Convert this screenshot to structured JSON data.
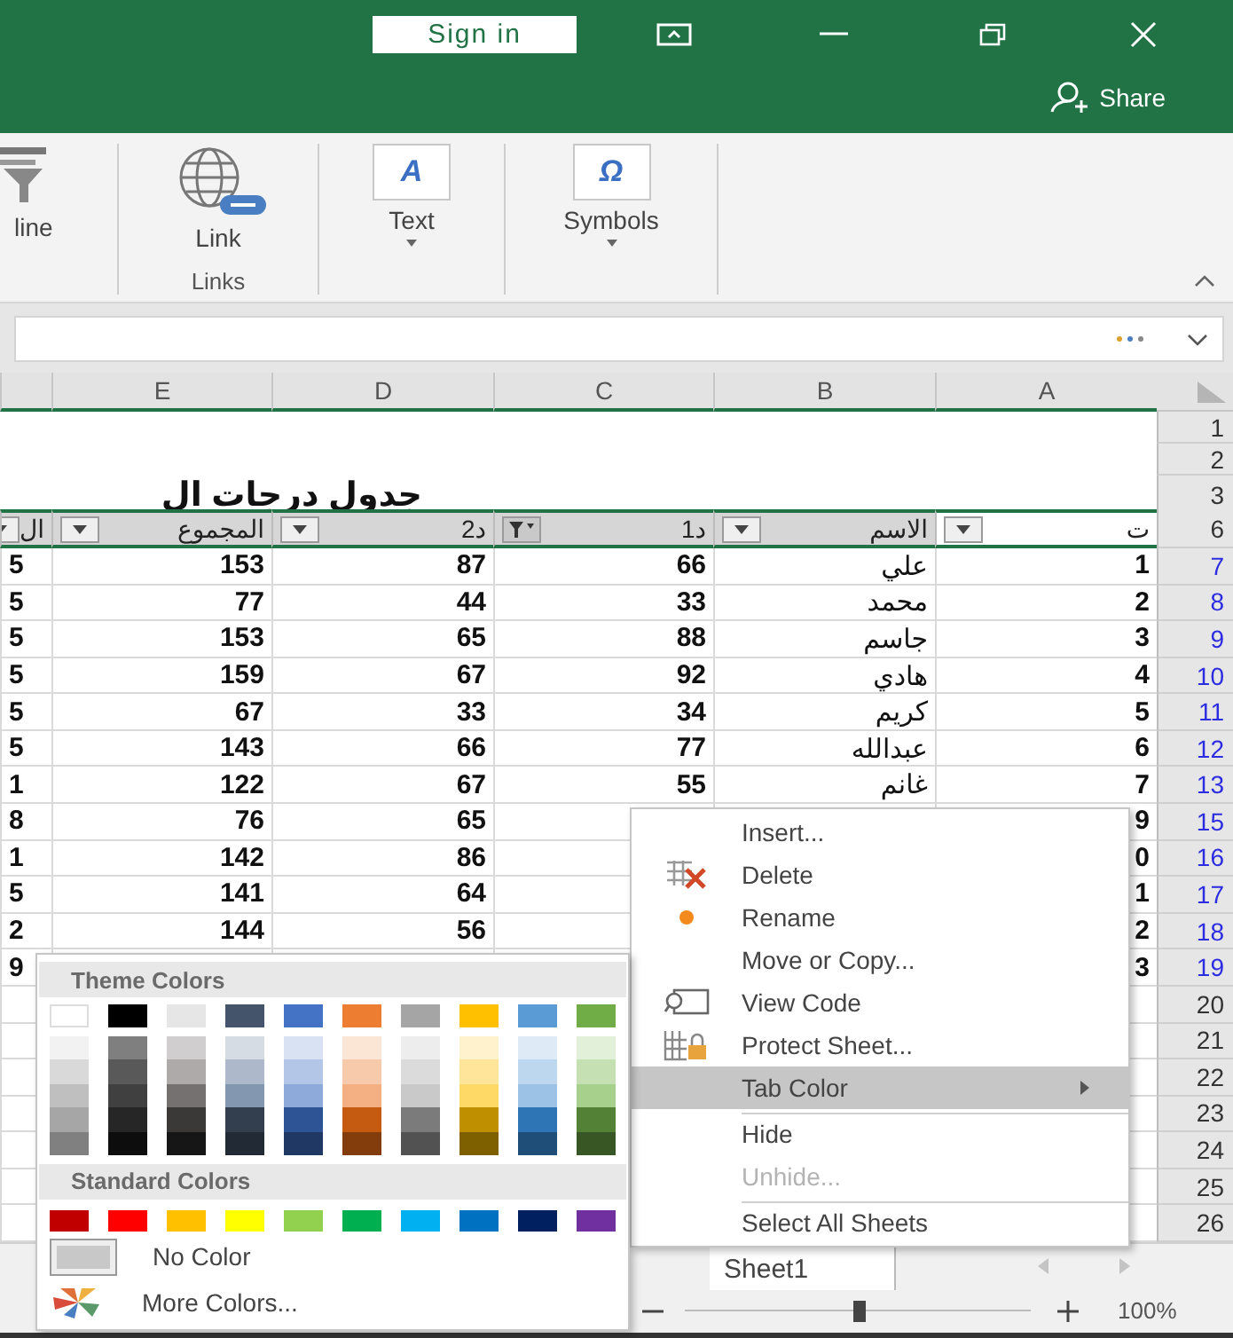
{
  "title_bar": {
    "sign_in": "Sign in",
    "share": "Share"
  },
  "ribbon": {
    "groups": [
      {
        "buttons": [
          {
            "label": "line",
            "dropdown": false
          }
        ]
      },
      {
        "buttons": [
          {
            "label": "Link",
            "dropdown": false
          }
        ],
        "label": "Links"
      },
      {
        "buttons": [
          {
            "label": "Text",
            "glyph": "A",
            "dropdown": true
          }
        ]
      },
      {
        "buttons": [
          {
            "label": "Symbols",
            "glyph": "Ω",
            "dropdown": true
          }
        ]
      }
    ]
  },
  "sheet": {
    "columns": [
      "E",
      "D",
      "C",
      "B",
      "A"
    ],
    "title": "جدول درجات ال",
    "header": [
      {
        "text": "ت",
        "selected": true,
        "filtered": false
      },
      {
        "text": "الاسم",
        "selected": false,
        "filtered": false
      },
      {
        "text": "د1",
        "selected": false,
        "filtered": true
      },
      {
        "text": "د2",
        "selected": false,
        "filtered": false
      },
      {
        "text": "المجموع",
        "selected": false,
        "filtered": false
      },
      {
        "text": "ال",
        "selected": false,
        "filtered": false
      }
    ],
    "rows": [
      {
        "number": "1",
        "kind": "blank",
        "filtered": false
      },
      {
        "number": "2",
        "kind": "blank",
        "filtered": false
      },
      {
        "number": "3",
        "kind": "title",
        "filtered": false
      },
      {
        "number": "6",
        "kind": "header",
        "filtered": false
      },
      {
        "number": "7",
        "kind": "data",
        "filtered": true,
        "cells": {
          "a": "1",
          "b": "علي",
          "c": "66",
          "d": "87",
          "e": "153",
          "f": "5"
        }
      },
      {
        "number": "8",
        "kind": "data",
        "filtered": true,
        "cells": {
          "a": "2",
          "b": "محمد",
          "c": "33",
          "d": "44",
          "e": "77",
          "f": "5"
        }
      },
      {
        "number": "9",
        "kind": "data",
        "filtered": true,
        "cells": {
          "a": "3",
          "b": "جاسم",
          "c": "88",
          "d": "65",
          "e": "153",
          "f": "5"
        }
      },
      {
        "number": "10",
        "kind": "data",
        "filtered": true,
        "cells": {
          "a": "4",
          "b": "هادي",
          "c": "92",
          "d": "67",
          "e": "159",
          "f": "5"
        }
      },
      {
        "number": "11",
        "kind": "data",
        "filtered": true,
        "cells": {
          "a": "5",
          "b": "كريم",
          "c": "34",
          "d": "33",
          "e": "67",
          "f": "5"
        }
      },
      {
        "number": "12",
        "kind": "data",
        "filtered": true,
        "cells": {
          "a": "6",
          "b": "عبدالله",
          "c": "77",
          "d": "66",
          "e": "143",
          "f": "5"
        }
      },
      {
        "number": "13",
        "kind": "data",
        "filtered": true,
        "cells": {
          "a": "7",
          "b": "غانم",
          "c": "55",
          "d": "67",
          "e": "122",
          "f": "1"
        }
      },
      {
        "number": "15",
        "kind": "data",
        "filtered": true,
        "cells": {
          "a": "9",
          "d": "65",
          "e": "76",
          "f": "8"
        }
      },
      {
        "number": "16",
        "kind": "data",
        "filtered": true,
        "cells": {
          "a": "0",
          "d": "86",
          "e": "142",
          "f": "1"
        }
      },
      {
        "number": "17",
        "kind": "data",
        "filtered": true,
        "cells": {
          "a": "1",
          "d": "64",
          "e": "141",
          "f": "5"
        }
      },
      {
        "number": "18",
        "kind": "data",
        "filtered": true,
        "cells": {
          "a": "2",
          "d": "56",
          "e": "144",
          "f": "2"
        }
      },
      {
        "number": "19",
        "kind": "data",
        "filtered": true,
        "cells": {
          "a": "3",
          "f": "9"
        }
      },
      {
        "number": "20",
        "kind": "data",
        "filtered": false
      },
      {
        "number": "21",
        "kind": "data",
        "filtered": false
      },
      {
        "number": "22",
        "kind": "data",
        "filtered": false
      },
      {
        "number": "23",
        "kind": "data",
        "filtered": false
      },
      {
        "number": "24",
        "kind": "data",
        "filtered": false
      },
      {
        "number": "25",
        "kind": "data",
        "filtered": false
      },
      {
        "number": "26",
        "kind": "data",
        "filtered": false
      }
    ]
  },
  "context_menu": {
    "items": [
      {
        "label": "Insert...",
        "selected": false,
        "disabled": false,
        "submenu": false,
        "separator_before": false
      },
      {
        "label": "Delete",
        "selected": false,
        "disabled": false,
        "submenu": false,
        "separator_before": false
      },
      {
        "label": "Rename",
        "selected": false,
        "disabled": false,
        "submenu": false,
        "separator_before": false
      },
      {
        "label": "Move or Copy...",
        "selected": false,
        "disabled": false,
        "submenu": false,
        "separator_before": false
      },
      {
        "label": "View Code",
        "selected": false,
        "disabled": false,
        "submenu": false,
        "separator_before": false
      },
      {
        "label": "Protect Sheet...",
        "selected": false,
        "disabled": false,
        "submenu": false,
        "separator_before": false
      },
      {
        "label": "Tab Color",
        "selected": true,
        "disabled": false,
        "submenu": true,
        "separator_before": false
      },
      {
        "label": "Hide",
        "selected": false,
        "disabled": false,
        "submenu": false,
        "separator_before": true
      },
      {
        "label": "Unhide...",
        "selected": false,
        "disabled": true,
        "submenu": false,
        "separator_before": false
      },
      {
        "label": "Select All Sheets",
        "selected": false,
        "disabled": false,
        "submenu": false,
        "separator_before": true
      }
    ]
  },
  "palette": {
    "theme_title": "Theme Colors",
    "theme": [
      {
        "color": "#ffffff",
        "shades": [
          {
            "color": "#f2f2f2"
          },
          {
            "color": "#d9d9d9"
          },
          {
            "color": "#bfbfbf"
          },
          {
            "color": "#a6a6a6"
          },
          {
            "color": "#808080"
          }
        ]
      },
      {
        "color": "#000000",
        "shades": [
          {
            "color": "#7f7f7f"
          },
          {
            "color": "#595959"
          },
          {
            "color": "#404040"
          },
          {
            "color": "#262626"
          },
          {
            "color": "#0d0d0d"
          }
        ]
      },
      {
        "color": "#e7e6e6",
        "shades": [
          {
            "color": "#d0cece"
          },
          {
            "color": "#aeaaaa"
          },
          {
            "color": "#757171"
          },
          {
            "color": "#3b3838"
          },
          {
            "color": "#171616"
          }
        ]
      },
      {
        "color": "#44546a",
        "shades": [
          {
            "color": "#d6dce4"
          },
          {
            "color": "#adb9ca"
          },
          {
            "color": "#8497b0"
          },
          {
            "color": "#333f4f"
          },
          {
            "color": "#222a35"
          }
        ]
      },
      {
        "color": "#4472c4",
        "shades": [
          {
            "color": "#d9e2f3"
          },
          {
            "color": "#b4c6e7"
          },
          {
            "color": "#8eaadb"
          },
          {
            "color": "#2f5496"
          },
          {
            "color": "#1f3864"
          }
        ]
      },
      {
        "color": "#ed7d31",
        "shades": [
          {
            "color": "#fbe5d5"
          },
          {
            "color": "#f7caac"
          },
          {
            "color": "#f4b083"
          },
          {
            "color": "#c55a11"
          },
          {
            "color": "#833c0b"
          }
        ]
      },
      {
        "color": "#a5a5a5",
        "shades": [
          {
            "color": "#ededed"
          },
          {
            "color": "#dbdbdb"
          },
          {
            "color": "#c9c9c9"
          },
          {
            "color": "#7b7b7b"
          },
          {
            "color": "#525252"
          }
        ]
      },
      {
        "color": "#ffc000",
        "shades": [
          {
            "color": "#fff2cc"
          },
          {
            "color": "#ffe599"
          },
          {
            "color": "#ffd966"
          },
          {
            "color": "#bf8f00"
          },
          {
            "color": "#7f6000"
          }
        ]
      },
      {
        "color": "#5b9bd5",
        "shades": [
          {
            "color": "#deebf6"
          },
          {
            "color": "#bdd7ee"
          },
          {
            "color": "#9cc3e5"
          },
          {
            "color": "#2e75b5"
          },
          {
            "color": "#1f4e79"
          }
        ]
      },
      {
        "color": "#70ad47",
        "shades": [
          {
            "color": "#e2efd9"
          },
          {
            "color": "#c5e0b3"
          },
          {
            "color": "#a8d08d"
          },
          {
            "color": "#538135"
          },
          {
            "color": "#375623"
          }
        ]
      }
    ],
    "standard_title": "Standard Colors",
    "standard": [
      {
        "color": "#c00000"
      },
      {
        "color": "#ff0000"
      },
      {
        "color": "#ffc000"
      },
      {
        "color": "#ffff00"
      },
      {
        "color": "#92d050"
      },
      {
        "color": "#00b050"
      },
      {
        "color": "#00b0f0"
      },
      {
        "color": "#0070c0"
      },
      {
        "color": "#002060"
      },
      {
        "color": "#7030a0"
      }
    ],
    "no_color": "No Color",
    "more_colors": "More Colors..."
  },
  "sheet_tabs": [
    {
      "name": "Sheet1",
      "selected": true
    }
  ],
  "status_bar": {
    "zoom": {
      "level": 0.5,
      "reading": "100%"
    }
  }
}
